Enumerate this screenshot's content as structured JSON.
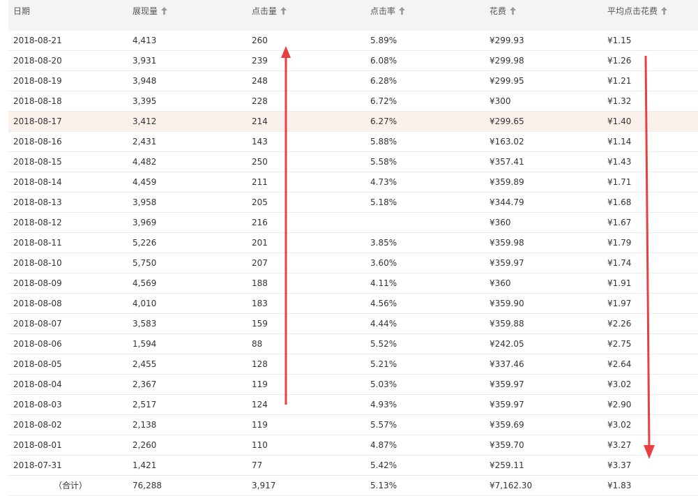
{
  "table": {
    "headers": [
      {
        "label": "日期",
        "sortable": false
      },
      {
        "label": "展现量",
        "sortable": true
      },
      {
        "label": "点击量",
        "sortable": true
      },
      {
        "label": "点击率",
        "sortable": true
      },
      {
        "label": "花费",
        "sortable": true
      },
      {
        "label": "平均点击花费",
        "sortable": true
      }
    ],
    "highlight_color": "#fbf1ec",
    "highlighted_row": 4,
    "rows": [
      [
        "2018-08-21",
        "4,413",
        "260",
        "5.89%",
        "¥299.93",
        "¥1.15"
      ],
      [
        "2018-08-20",
        "3,931",
        "239",
        "6.08%",
        "¥299.98",
        "¥1.26"
      ],
      [
        "2018-08-19",
        "3,948",
        "248",
        "6.28%",
        "¥299.95",
        "¥1.21"
      ],
      [
        "2018-08-18",
        "3,395",
        "228",
        "6.72%",
        "¥300",
        "¥1.32"
      ],
      [
        "2018-08-17",
        "3,412",
        "214",
        "6.27%",
        "¥299.65",
        "¥1.40"
      ],
      [
        "2018-08-16",
        "2,431",
        "143",
        "5.88%",
        "¥163.02",
        "¥1.14"
      ],
      [
        "2018-08-15",
        "4,482",
        "250",
        "5.58%",
        "¥357.41",
        "¥1.43"
      ],
      [
        "2018-08-14",
        "4,459",
        "211",
        "4.73%",
        "¥359.89",
        "¥1.71"
      ],
      [
        "2018-08-13",
        "3,958",
        "205",
        "5.18%",
        "¥344.79",
        "¥1.68"
      ],
      [
        "2018-08-12",
        "3,969",
        "216",
        "",
        "¥360",
        "¥1.67"
      ],
      [
        "2018-08-11",
        "5,226",
        "201",
        "3.85%",
        "¥359.98",
        "¥1.79"
      ],
      [
        "2018-08-10",
        "5,750",
        "207",
        "3.60%",
        "¥359.97",
        "¥1.74"
      ],
      [
        "2018-08-09",
        "4,569",
        "188",
        "4.11%",
        "¥360",
        "¥1.91"
      ],
      [
        "2018-08-08",
        "4,010",
        "183",
        "4.56%",
        "¥359.90",
        "¥1.97"
      ],
      [
        "2018-08-07",
        "3,583",
        "159",
        "4.44%",
        "¥359.88",
        "¥2.26"
      ],
      [
        "2018-08-06",
        "1,594",
        "88",
        "5.52%",
        "¥242.05",
        "¥2.75"
      ],
      [
        "2018-08-05",
        "2,455",
        "128",
        "5.21%",
        "¥337.46",
        "¥2.64"
      ],
      [
        "2018-08-04",
        "2,367",
        "119",
        "5.03%",
        "¥359.97",
        "¥3.02"
      ],
      [
        "2018-08-03",
        "2,517",
        "124",
        "4.93%",
        "¥359.97",
        "¥2.90"
      ],
      [
        "2018-08-02",
        "2,138",
        "119",
        "5.57%",
        "¥359.69",
        "¥3.02"
      ],
      [
        "2018-08-01",
        "2,260",
        "110",
        "4.87%",
        "¥359.70",
        "¥3.27"
      ],
      [
        "2018-07-31",
        "1,421",
        "77",
        "5.42%",
        "¥259.11",
        "¥3.37"
      ]
    ],
    "total": [
      "（合计）",
      "76,288",
      "3,917",
      "5.13%",
      "¥7,162.30",
      "¥1.83"
    ]
  },
  "annotations": {
    "color": "#e8403e",
    "click_trend": "up-arrow",
    "avg_cost_trend": "down-arrow"
  }
}
